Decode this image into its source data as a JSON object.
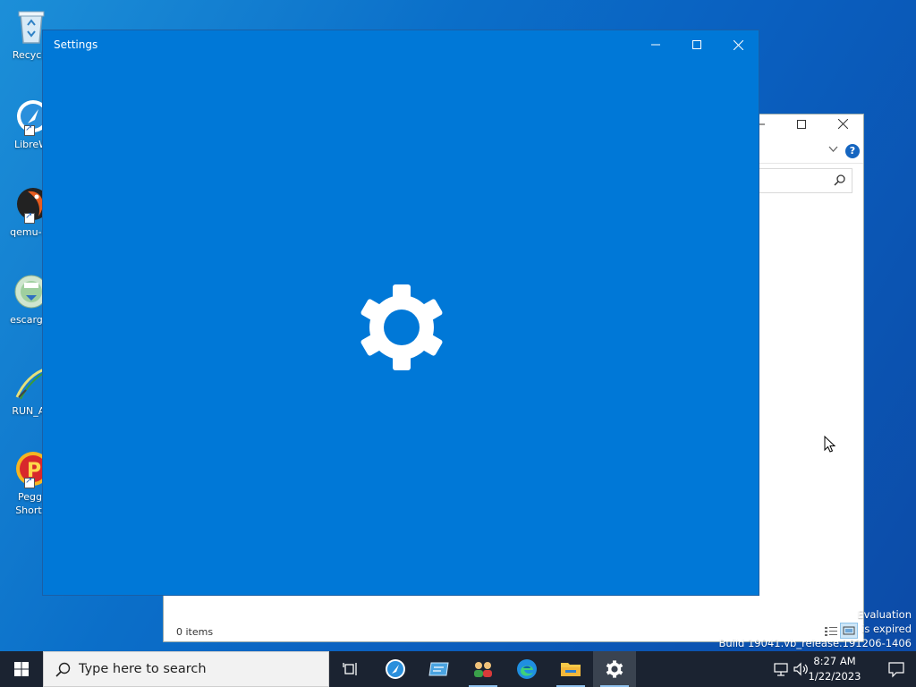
{
  "desktop": {
    "icons": [
      {
        "label": "Recycle",
        "icon": "recycle-bin-icon"
      },
      {
        "label": "LibreW",
        "icon": "librewolf-icon"
      },
      {
        "label": "qemu-sy",
        "icon": "qemu-icon"
      },
      {
        "label": "escargot",
        "icon": "escargot-icon"
      },
      {
        "label": "RUN_AF",
        "icon": "run-af-icon"
      },
      {
        "label": "Peggl",
        "label2": "Shortc",
        "icon": "peggle-icon"
      }
    ]
  },
  "explorer": {
    "status": "0 items",
    "help": "?"
  },
  "settings_window": {
    "title": "Settings"
  },
  "watermark": {
    "line1": "Evaluation",
    "line2": "is expired",
    "line3": "Build 19041.vb_release.191206-1406"
  },
  "taskbar": {
    "search_placeholder": "Type here to search",
    "time": "8:27 AM",
    "date": "1/22/2023",
    "apps": [
      "task-view",
      "app-blue-circle",
      "app-blue-window",
      "people-app",
      "edge",
      "file-explorer",
      "settings"
    ]
  },
  "colors": {
    "settings_bg": "#0078d7",
    "taskbar_bg": "#1b2331",
    "accent": "#0078d7"
  }
}
